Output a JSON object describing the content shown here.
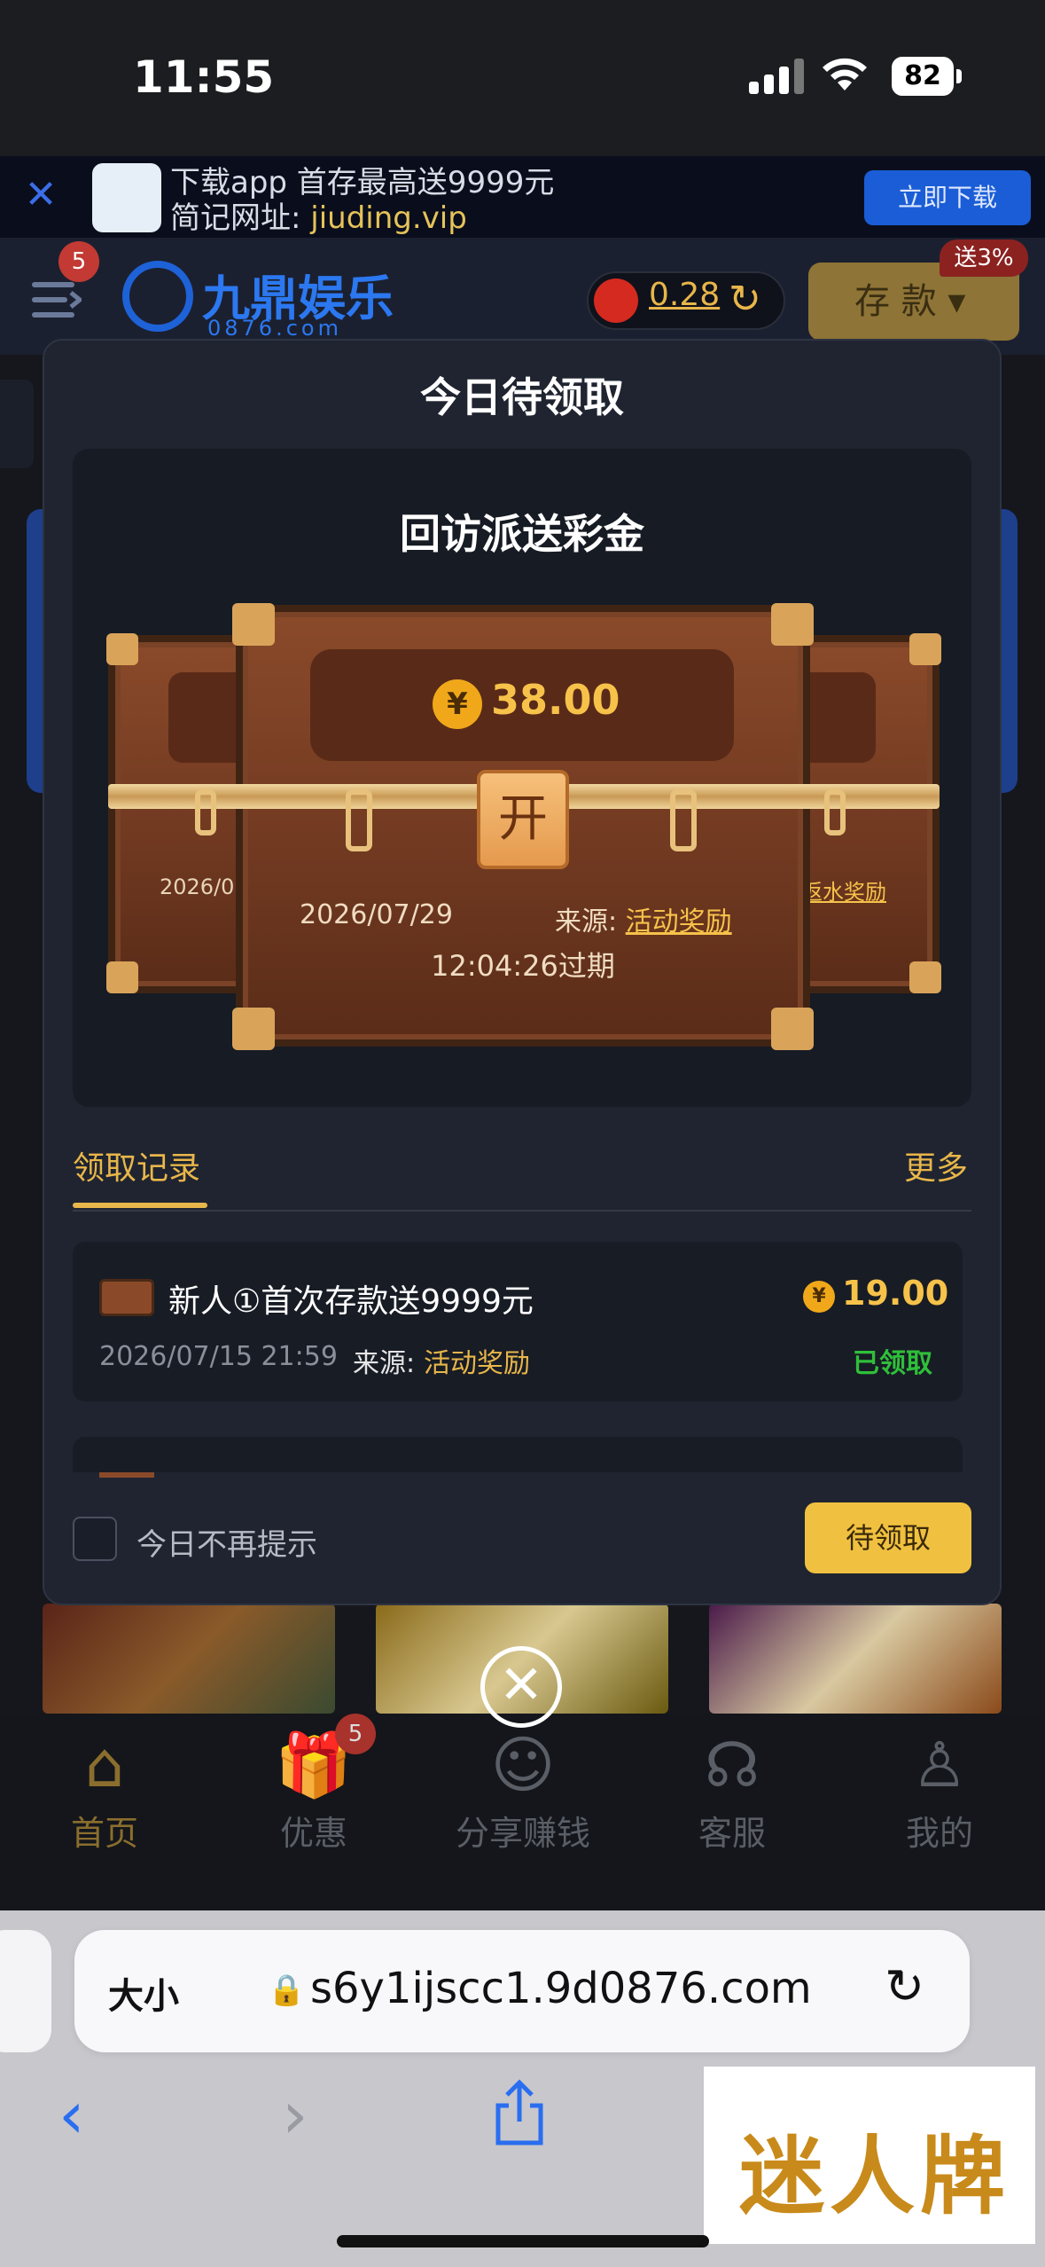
{
  "status_bar": {
    "time": "11:55",
    "battery": "82"
  },
  "download_banner": {
    "line1": "下载app 首存最高送9999元",
    "line2_label": "简记网址:",
    "line2_url": "jiuding.vip",
    "button": "立即下载"
  },
  "header": {
    "menu_badge": "5",
    "brand_name": "九鼎娱乐",
    "brand_sub": "0876.com",
    "balance": "0.28",
    "deposit_label": "存 款",
    "deposit_badge": "送3%"
  },
  "modal": {
    "title": "今日待领取",
    "panel_title": "回访派送彩金",
    "main_chest": {
      "amount": "38.00",
      "lock_char": "开",
      "date": "2026/07/29",
      "source_label": "来源:",
      "source": "活动奖励",
      "expire": "12:04:26过期"
    },
    "side_left": {
      "date": "2026/07"
    },
    "side_right": {
      "source": "返水奖励"
    },
    "records_tab": "领取记录",
    "more": "更多",
    "record": {
      "title": "新人①首次存款送9999元",
      "amount": "19.00",
      "date": "2026/07/15 21:59",
      "source_label": "来源:",
      "source": "活动奖励",
      "status": "已领取"
    },
    "dont_show": "今日不再提示",
    "claim_button": "待领取"
  },
  "tabbar": {
    "badge": "5",
    "items": [
      {
        "label": "首页",
        "icon": "home-icon"
      },
      {
        "label": "优惠",
        "icon": "gift-icon"
      },
      {
        "label": "分享赚钱",
        "icon": "people-icon"
      },
      {
        "label": "客服",
        "icon": "headset-icon"
      },
      {
        "label": "我的",
        "icon": "user-icon"
      }
    ]
  },
  "browser": {
    "aa_label": "大小",
    "url": "s6y1ijscc1.9d0876.com"
  },
  "watermark": "迷人牌",
  "colors": {
    "accent": "#f0c040",
    "gold_text": "#f6c24a",
    "status_green": "#2fbf3a",
    "ios_blue": "#2a6ef0"
  }
}
